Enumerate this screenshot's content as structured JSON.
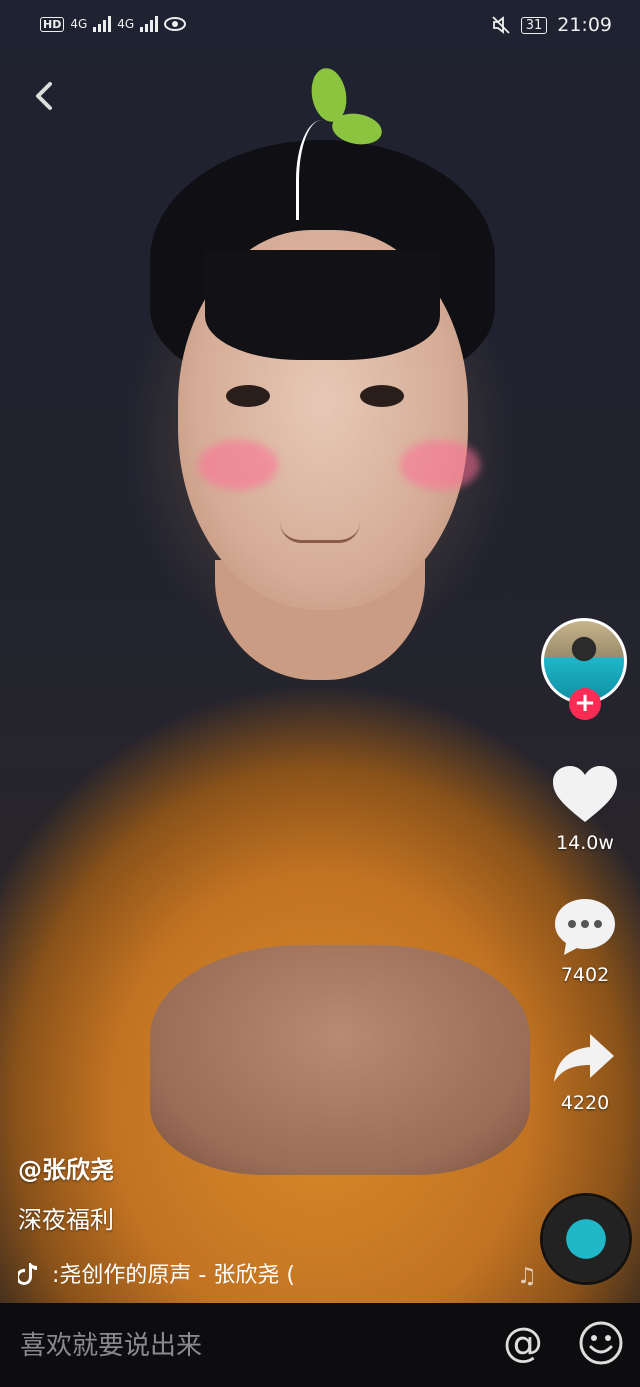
{
  "status_bar": {
    "hd": "HD",
    "network1": "4G",
    "network2": "4G",
    "battery": "31",
    "time": "21:09"
  },
  "author": {
    "handle": "@张欣尧"
  },
  "caption": "深夜福利",
  "music": {
    "text": ":尧创作的原声 - 张欣尧   ("
  },
  "actions": {
    "likes": "14.0w",
    "comments": "7402",
    "shares": "4220"
  },
  "comment_bar": {
    "placeholder": "喜欢就要说出来",
    "at_label": "@"
  },
  "colors": {
    "accent": "#fe2c55",
    "bottom_bar": "#0d0d0f"
  }
}
